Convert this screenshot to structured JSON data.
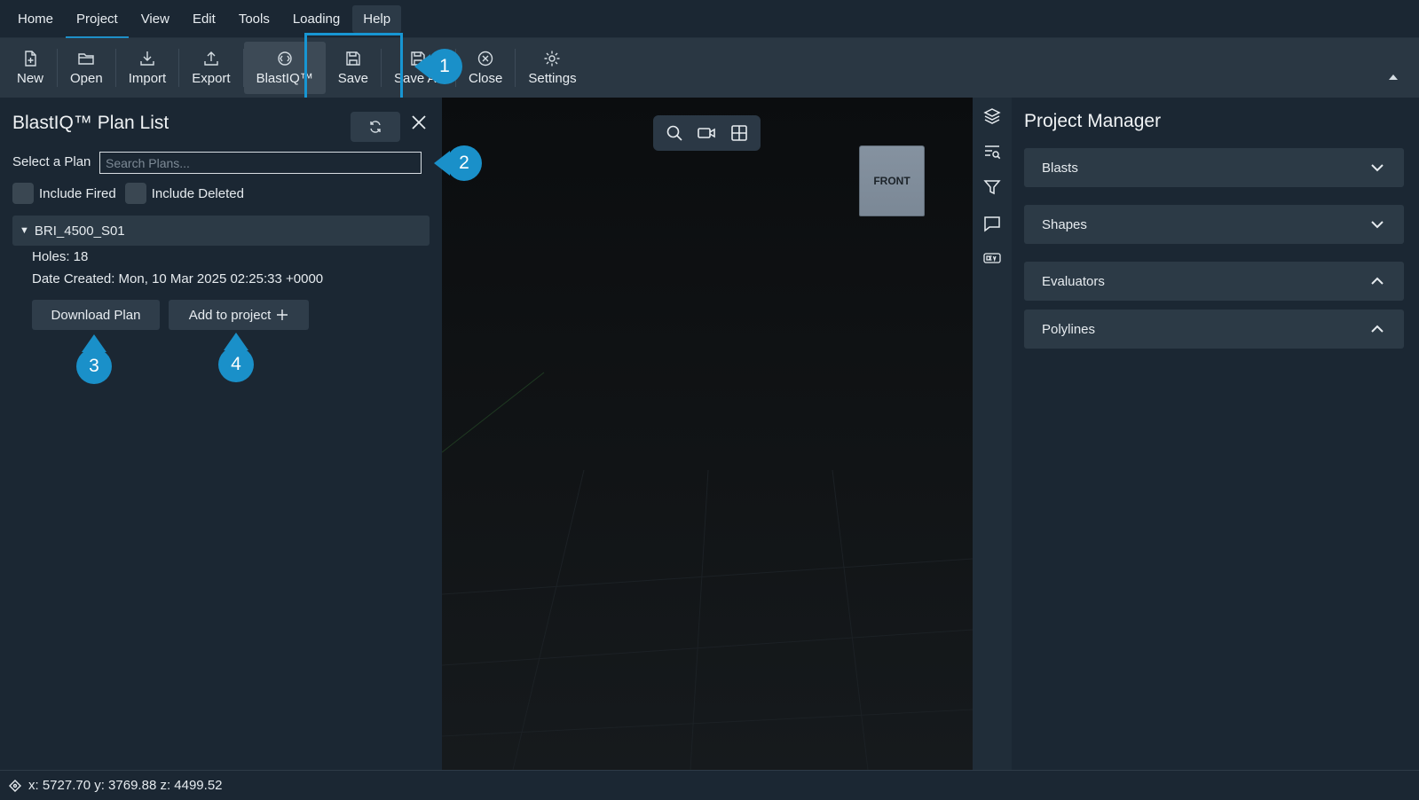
{
  "menu": {
    "items": [
      {
        "label": "Home"
      },
      {
        "label": "Project"
      },
      {
        "label": "View"
      },
      {
        "label": "Edit"
      },
      {
        "label": "Tools"
      },
      {
        "label": "Loading"
      },
      {
        "label": "Help"
      }
    ],
    "active": "Project"
  },
  "toolbar": {
    "items": [
      {
        "label": "New",
        "icon": "new-file-icon"
      },
      {
        "label": "Open",
        "icon": "folder-open-icon"
      },
      {
        "label": "Import",
        "icon": "download-icon"
      },
      {
        "label": "Export",
        "icon": "upload-icon"
      },
      {
        "label": "BlastIQ™",
        "icon": "blastiq-icon"
      },
      {
        "label": "Save",
        "icon": "save-icon"
      },
      {
        "label": "Save As",
        "icon": "save-as-icon"
      },
      {
        "label": "Close",
        "icon": "close-circle-icon"
      },
      {
        "label": "Settings",
        "icon": "gear-icon"
      }
    ]
  },
  "plan_list": {
    "title": "BlastIQ™ Plan List",
    "select_label": "Select a Plan",
    "search_placeholder": "Search Plans...",
    "include_fired": "Include Fired",
    "include_deleted": "Include Deleted",
    "plan": {
      "name": "BRI_4500_S01",
      "holes": "Holes: 18",
      "date_created": "Date Created: Mon, 10 Mar 2025 02:25:33 +0000",
      "download_label": "Download Plan",
      "add_label": "Add to project"
    }
  },
  "viewport": {
    "cube_face": "FRONT"
  },
  "project_manager": {
    "title": "Project Manager",
    "sections": [
      {
        "label": "Blasts",
        "state": "collapsed"
      },
      {
        "label": "Shapes",
        "state": "collapsed"
      },
      {
        "label": "Evaluators",
        "state": "expanded"
      },
      {
        "label": "Polylines",
        "state": "expanded"
      }
    ]
  },
  "status": {
    "coords": "x: 5727.70 y: 3769.88 z: 4499.52"
  },
  "callouts": [
    "1",
    "2",
    "3",
    "4"
  ],
  "colors": {
    "accent": "#1a90c9",
    "background": "#1b2733",
    "toolbar": "#2a3743"
  }
}
